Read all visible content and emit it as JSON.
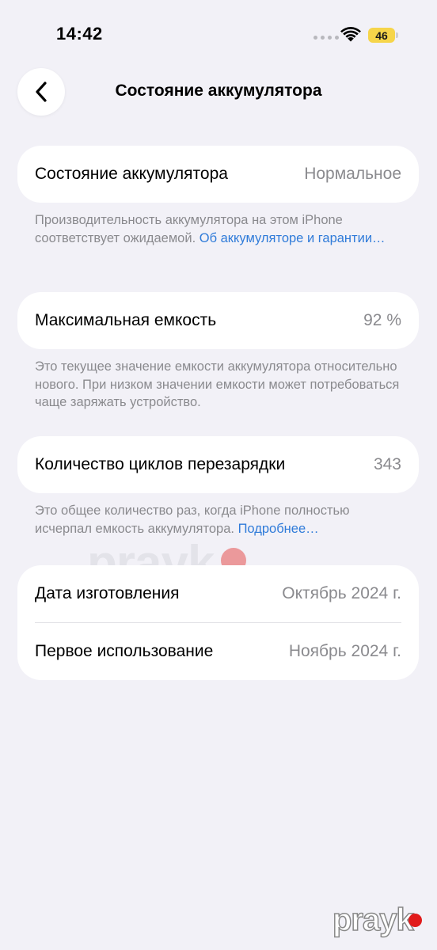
{
  "status_bar": {
    "time": "14:42",
    "battery_level": "46",
    "battery_color": "#f6d54a"
  },
  "nav": {
    "back_icon": "chevron-left-icon",
    "title": "Состояние аккумулятора"
  },
  "battery_health": {
    "label": "Состояние аккумулятора",
    "value": "Нормальное",
    "footnote_text": "Производительность аккумулятора на этом iPhone соответствует ожидаемой. ",
    "footnote_link": "Об аккумуляторе и гарантии…"
  },
  "max_capacity": {
    "label": "Максимальная емкость",
    "value": "92 %",
    "footnote_text": "Это текущее значение емкости аккумулятора относительно нового. При низком значении емкости может потребоваться чаще заряжать устройство."
  },
  "cycle_count": {
    "label": "Количество циклов перезарядки",
    "value": "343",
    "footnote_text": "Это общее количество раз, когда iPhone полностью исчерпал емкость аккумулятора. ",
    "footnote_link": "Подробнее…"
  },
  "dates": {
    "manufacture_label": "Дата изготовления",
    "manufacture_value": "Октябрь 2024 г.",
    "first_use_label": "Первое использование",
    "first_use_value": "Ноябрь 2024 г."
  },
  "watermark": {
    "text": "prayk",
    "dot_color": "#e11b1b"
  },
  "colors": {
    "background": "#f2f1f7",
    "link": "#2f7bd9",
    "secondary_text": "#8a8a8e"
  }
}
